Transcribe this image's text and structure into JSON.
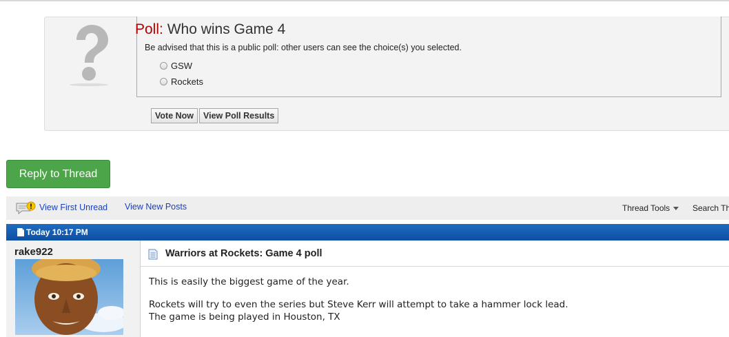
{
  "poll": {
    "label": "Poll:",
    "question": "Who wins Game 4",
    "notice": "Be advised that this is a public poll: other users can see the choice(s) you selected.",
    "options": [
      "GSW",
      "Rockets"
    ],
    "vote_label": "Vote Now",
    "results_label": "View Poll Results"
  },
  "reply_button": "Reply to Thread",
  "toolbar": {
    "view_first_unread": "View First Unread",
    "view_new_posts": "View New Posts",
    "thread_tools": "Thread Tools",
    "search_thread": "Search Th"
  },
  "post": {
    "date": "Today 10:17 PM",
    "username": "rake922",
    "title": "Warriors at Rockets: Game 4 poll",
    "lines": [
      "This is easily the biggest game of the year.",
      "Rockets will try to even the series but Steve Kerr will attempt to take a hammer lock lead.",
      "The game is being played in Houston, TX"
    ]
  },
  "colors": {
    "reply_green": "#4da54a",
    "header_blue": "#0d4fa3",
    "link_blue": "#1a3fb5",
    "poll_label_red": "#b40000"
  }
}
